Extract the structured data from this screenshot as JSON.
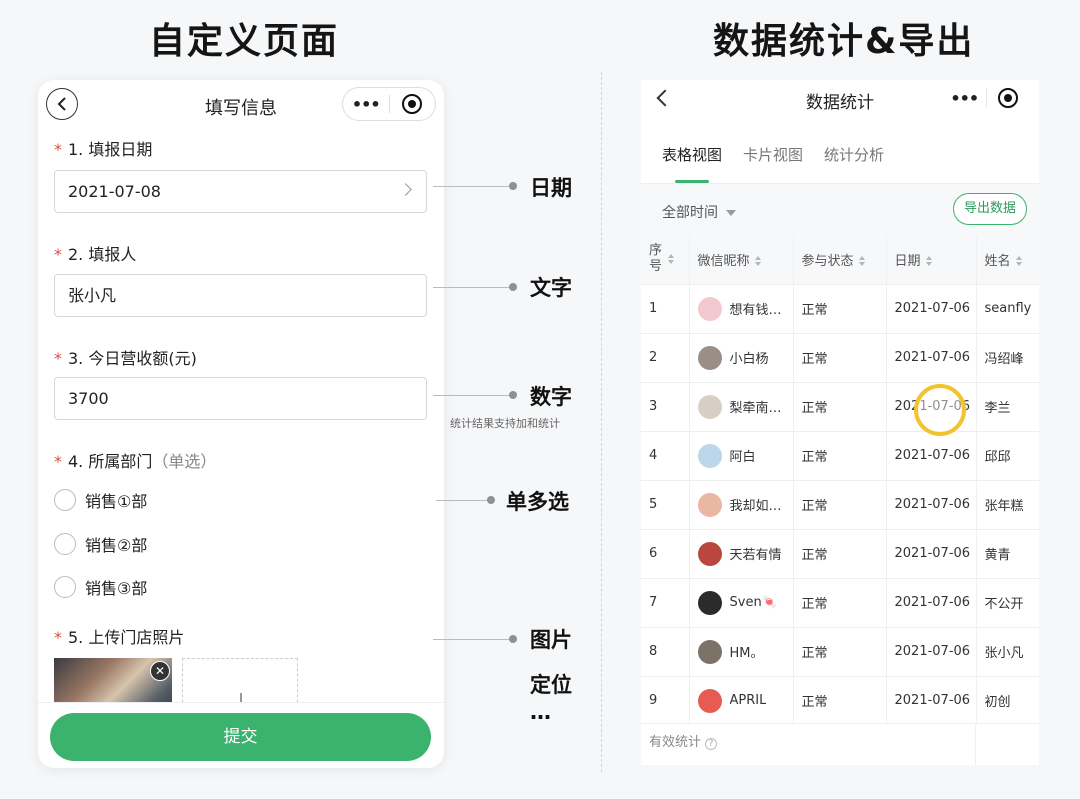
{
  "headings": {
    "left": "自定义页面",
    "right": "数据统计&导出"
  },
  "form": {
    "title": "填写信息",
    "capsule_more": "•••",
    "questions": [
      {
        "label": "1. 填报日期",
        "value": "2021-07-08"
      },
      {
        "label": "2. 填报人",
        "value": "张小凡"
      },
      {
        "label": "3. 今日营收额(元)",
        "value": "3700"
      },
      {
        "label": "4. 所属部门",
        "sub": "（单选）",
        "options": [
          "销售①部",
          "销售②部",
          "销售③部"
        ]
      },
      {
        "label": "5. 上传门店照片"
      }
    ],
    "required_mark": "*",
    "submit": "提交"
  },
  "annotations": {
    "date": "日期",
    "text": "文字",
    "number": "数字",
    "number_note": "统计结果支持加和统计",
    "choice": "单多选",
    "image": "图片",
    "location": "定位",
    "more": "…"
  },
  "stats": {
    "title": "数据统计",
    "capsule_more": "•••",
    "tabs": [
      "表格视图",
      "卡片视图",
      "统计分析"
    ],
    "active_tab": 0,
    "filter": "全部时间",
    "export": "导出数据",
    "columns": [
      "序号",
      "微信昵称",
      "参与状态",
      "日期",
      "姓名"
    ],
    "rows": [
      {
        "no": "1",
        "nick": "想有钱…",
        "status": "正常",
        "date": "2021-07-06",
        "name": "seanfly",
        "avatar": "#f2c9cf"
      },
      {
        "no": "2",
        "nick": "小白杨",
        "status": "正常",
        "date": "2021-07-06",
        "name": "冯绍峰",
        "avatar": "#9b8e86"
      },
      {
        "no": "3",
        "nick": "梨牵南…",
        "status": "正常",
        "date": "2021-07-06",
        "name": "李兰",
        "avatar": "#d8cfc4"
      },
      {
        "no": "4",
        "nick": "阿白",
        "status": "正常",
        "date": "2021-07-06",
        "name": "邱邱",
        "avatar": "#bcd7ea"
      },
      {
        "no": "5",
        "nick": "我却如…",
        "status": "正常",
        "date": "2021-07-06",
        "name": "张年糕",
        "avatar": "#e9b7a2"
      },
      {
        "no": "6",
        "nick": "天若有情",
        "status": "正常",
        "date": "2021-07-06",
        "name": "黄青",
        "avatar": "#b9463f"
      },
      {
        "no": "7",
        "nick": "Sven🍬",
        "status": "正常",
        "date": "2021-07-06",
        "name": "不公开",
        "avatar": "#2b2b2b"
      },
      {
        "no": "8",
        "nick": "HM。",
        "status": "正常",
        "date": "2021-07-06",
        "name": "张小凡",
        "avatar": "#7d7268"
      },
      {
        "no": "9",
        "nick": "APRIL",
        "status": "正常",
        "date": "2021-07-06",
        "name": "初创",
        "avatar": "#e65c52"
      }
    ],
    "summary": "有效统计",
    "help": "?"
  }
}
